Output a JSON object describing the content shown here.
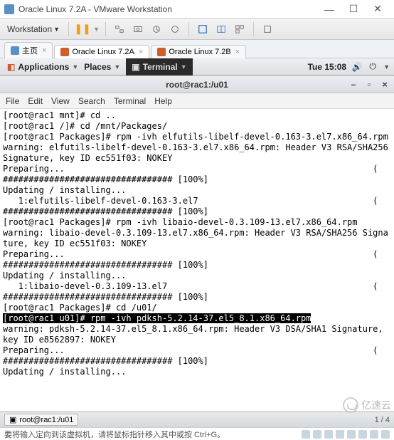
{
  "window": {
    "title": "Oracle Linux 7.2A - VMware Workstation"
  },
  "vmware": {
    "menu_label": "Workstation",
    "tabs": [
      {
        "label": "主页",
        "home": true
      },
      {
        "label": "Oracle Linux 7.2A",
        "active": true
      },
      {
        "label": "Oracle Linux 7.2B"
      }
    ]
  },
  "gnome": {
    "applications": "Applications",
    "places": "Places",
    "terminal": "Terminal",
    "clock": "Tue 15:08"
  },
  "terminal": {
    "title": "root@rac1:/u01",
    "menu": [
      "File",
      "Edit",
      "View",
      "Search",
      "Terminal",
      "Help"
    ],
    "lines": [
      {
        "t": "[root@rac1 mnt]# cd .."
      },
      {
        "t": "[root@rac1 /]# cd /mnt/Packages/"
      },
      {
        "t": "[root@rac1 Packages]# rpm -ivh elfutils-libelf-devel-0.163-3.el7.x86_64.rpm"
      },
      {
        "t": "warning: elfutils-libelf-devel-0.163-3.el7.x86_64.rpm: Header V3 RSA/SHA256 Signature, key ID ec551f03: NOKEY"
      },
      {
        "t": "Preparing...                                                            ("
      },
      {
        "t": "################################# [100%]"
      },
      {
        "t": "Updating / installing..."
      },
      {
        "t": "   1:elfutils-libelf-devel-0.163-3.el7                                  ("
      },
      {
        "t": "################################# [100%]"
      },
      {
        "t": "[root@rac1 Packages]# rpm -ivh libaio-devel-0.3.109-13.el7.x86_64.rpm"
      },
      {
        "t": "warning: libaio-devel-0.3.109-13.el7.x86_64.rpm: Header V3 RSA/SHA256 Signature, key ID ec551f03: NOKEY"
      },
      {
        "t": "Preparing...                                                            ("
      },
      {
        "t": "################################# [100%]"
      },
      {
        "t": "Updating / installing..."
      },
      {
        "t": "   1:libaio-devel-0.3.109-13.el7                                        ("
      },
      {
        "t": "################################# [100%]"
      },
      {
        "t": "[root@rac1 Packages]# cd /u01/"
      },
      {
        "t": "[root@rac1 u01]# rpm -ivh pdksh-5.2.14-37.el5_8.1.x86_64.rpm",
        "hl": true
      },
      {
        "t": "warning: pdksh-5.2.14-37.el5_8.1.x86_64.rpm: Header V3 DSA/SHA1 Signature, key ID e8562897: NOKEY"
      },
      {
        "t": "Preparing...                                                            ("
      },
      {
        "t": "################################# [100%]"
      },
      {
        "t": "Updating / installing..."
      }
    ]
  },
  "taskbar": {
    "item": "root@rac1:/u01",
    "pager": "1 / 4"
  },
  "status": {
    "text": "要将输入定向到该虚拟机，请将鼠标指针移入其中或按 Ctrl+G。"
  },
  "watermark": "亿速云"
}
